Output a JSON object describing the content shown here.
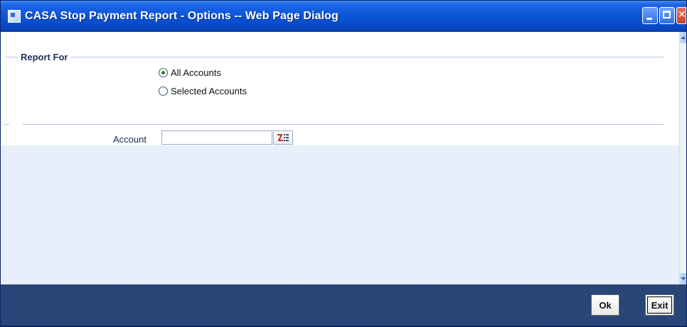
{
  "window": {
    "title": "CASA Stop Payment Report - Options -- Web Page Dialog"
  },
  "report_for": {
    "label": "Report For",
    "options": [
      {
        "label": "All Accounts",
        "selected": true
      },
      {
        "label": "Selected Accounts",
        "selected": false
      }
    ]
  },
  "account": {
    "label": "Account",
    "value": ""
  },
  "footer": {
    "ok_label": "Ok",
    "exit_label": "Exit"
  },
  "icons": {
    "title": "window-icon",
    "lov": "list-of-values-icon"
  },
  "colors": {
    "title_bar": "#0a55d8",
    "footer": "#2a4678",
    "lower_panel": "#e6effa"
  }
}
